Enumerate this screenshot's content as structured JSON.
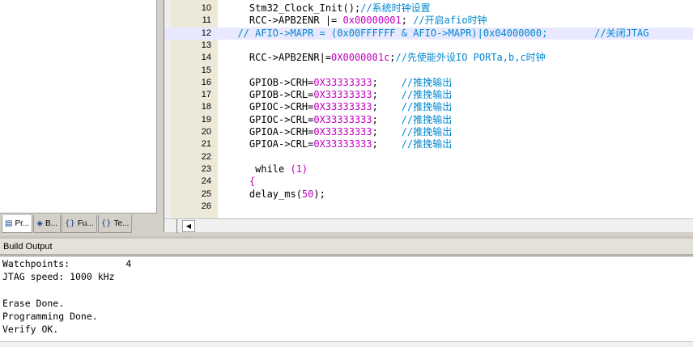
{
  "project": {
    "tabs": [
      {
        "label": "Pr...",
        "icon": "project-icon",
        "glyph": "▤"
      },
      {
        "label": "B...",
        "icon": "books-icon",
        "glyph": "◈"
      },
      {
        "label": "Fu...",
        "icon": "functions-icon",
        "glyph": "{}"
      },
      {
        "label": "Te...",
        "icon": "templates-icon",
        "glyph": "{}"
      }
    ]
  },
  "editor": {
    "lines": [
      {
        "num": "10",
        "parts": [
          {
            "t": "    Stm32_Clock_Init();",
            "c": "kw"
          },
          {
            "t": "//系统时钟设置",
            "c": "cmt"
          }
        ]
      },
      {
        "num": "11",
        "parts": [
          {
            "t": "    RCC->APB2ENR |= ",
            "c": "kw"
          },
          {
            "t": "0x00000001",
            "c": "num"
          },
          {
            "t": "; ",
            "c": "kw"
          },
          {
            "t": "//开启afio时钟",
            "c": "cmt"
          }
        ]
      },
      {
        "num": "12",
        "highlight": true,
        "parts": [
          {
            "t": "  // AFIO->MAPR = (0x00FFFFFF & AFIO->MAPR)|0x04000000;        //关闭JTAG",
            "c": "cmt"
          }
        ]
      },
      {
        "num": "13",
        "parts": []
      },
      {
        "num": "14",
        "parts": [
          {
            "t": "    RCC->APB2ENR|=",
            "c": "kw"
          },
          {
            "t": "0X0000001c",
            "c": "num"
          },
          {
            "t": ";",
            "c": "kw"
          },
          {
            "t": "//先使能外设IO PORTa,b,c时钟",
            "c": "cmt"
          }
        ]
      },
      {
        "num": "15",
        "parts": []
      },
      {
        "num": "16",
        "parts": [
          {
            "t": "    GPIOB->CRH=",
            "c": "kw"
          },
          {
            "t": "0X33333333",
            "c": "num"
          },
          {
            "t": ";    ",
            "c": "kw"
          },
          {
            "t": "//推挽输出",
            "c": "cmt"
          }
        ]
      },
      {
        "num": "17",
        "parts": [
          {
            "t": "    GPIOB->CRL=",
            "c": "kw"
          },
          {
            "t": "0X33333333",
            "c": "num"
          },
          {
            "t": ";    ",
            "c": "kw"
          },
          {
            "t": "//推挽输出",
            "c": "cmt"
          }
        ]
      },
      {
        "num": "18",
        "parts": [
          {
            "t": "    GPIOC->CRH=",
            "c": "kw"
          },
          {
            "t": "0X33333333",
            "c": "num"
          },
          {
            "t": ";    ",
            "c": "kw"
          },
          {
            "t": "//推挽输出",
            "c": "cmt"
          }
        ]
      },
      {
        "num": "19",
        "parts": [
          {
            "t": "    GPIOC->CRL=",
            "c": "kw"
          },
          {
            "t": "0X33333333",
            "c": "num"
          },
          {
            "t": ";    ",
            "c": "kw"
          },
          {
            "t": "//推挽输出",
            "c": "cmt"
          }
        ]
      },
      {
        "num": "20",
        "parts": [
          {
            "t": "    GPIOA->CRH=",
            "c": "kw"
          },
          {
            "t": "0X33333333",
            "c": "num"
          },
          {
            "t": ";    ",
            "c": "kw"
          },
          {
            "t": "//推挽输出",
            "c": "cmt"
          }
        ]
      },
      {
        "num": "21",
        "parts": [
          {
            "t": "    GPIOA->CRL=",
            "c": "kw"
          },
          {
            "t": "0X33333333",
            "c": "num"
          },
          {
            "t": ";    ",
            "c": "kw"
          },
          {
            "t": "//推挽输出",
            "c": "cmt"
          }
        ]
      },
      {
        "num": "22",
        "parts": []
      },
      {
        "num": "23",
        "parts": [
          {
            "t": "     while ",
            "c": "kw"
          },
          {
            "t": "(1)",
            "c": "num"
          }
        ]
      },
      {
        "num": "24",
        "parts": [
          {
            "t": "    {",
            "c": "num"
          }
        ]
      },
      {
        "num": "25",
        "parts": [
          {
            "t": "    delay_ms(",
            "c": "kw"
          },
          {
            "t": "50",
            "c": "num"
          },
          {
            "t": ");",
            "c": "kw"
          }
        ]
      },
      {
        "num": "26",
        "parts": []
      }
    ]
  },
  "build": {
    "title": "Build Output",
    "lines": [
      "Watchpoints:          4",
      "JTAG speed: 1000 kHz",
      "",
      "Erase Done.",
      "Programming Done.",
      "Verify OK."
    ]
  },
  "colors": {
    "comment": "#0088d0",
    "number": "#c000c0",
    "highlight_line": "#e8e8ff",
    "gutter": "#ece9d8"
  }
}
